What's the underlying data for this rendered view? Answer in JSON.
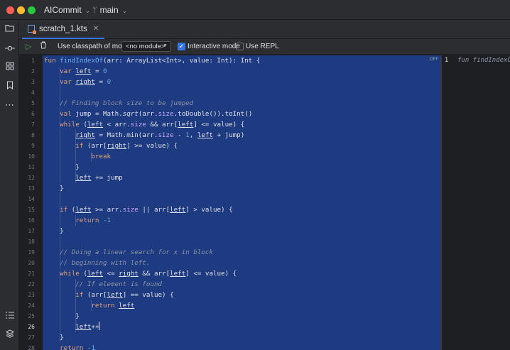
{
  "titlebar": {
    "project": "AICommit",
    "branch": "main"
  },
  "tab": {
    "label": "scratch_1.kts"
  },
  "toolbar": {
    "classpath_label": "Use classpath of module",
    "module_select": "<no module>",
    "interactive_label": "Interactive mode",
    "interactive_checked": true,
    "repl_label": "Use REPL",
    "repl_checked": false
  },
  "editor": {
    "off_badge": "OFF",
    "current_line": "26",
    "line_numbers": [
      "1",
      "2",
      "3",
      "4",
      "5",
      "6",
      "7",
      "8",
      "9",
      "10",
      "11",
      "12",
      "13",
      "14",
      "15",
      "16",
      "17",
      "18",
      "19",
      "20",
      "21",
      "22",
      "23",
      "24",
      "25",
      "26",
      "27",
      "28"
    ]
  },
  "preview": {
    "line": "1",
    "text": "fun findIndexOf(arr: ArrayList<Int>, value: Int): Int {"
  },
  "colors": {
    "selection": "#1e3a80",
    "accent": "#3574f0",
    "keyword": "#e0a57a",
    "function": "#6fb0f0",
    "number": "#6fa8dc",
    "property": "#c8a8ff",
    "comment": "#8d95a8"
  },
  "icons": {
    "left": [
      "folder-icon",
      "commit-icon",
      "structure-icon",
      "bookmark-icon",
      "more-icon",
      "list-icon",
      "layers-icon"
    ],
    "toolbar": [
      "run-icon",
      "trash-icon"
    ]
  }
}
